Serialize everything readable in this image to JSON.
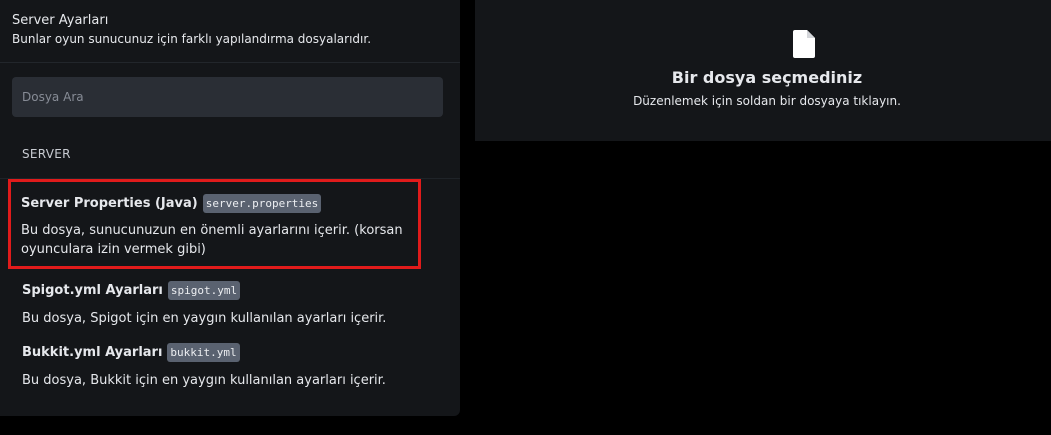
{
  "panel": {
    "title": "Server Ayarları",
    "subtitle": "Bunlar oyun sunucunuz için farklı yapılandırma dosyalarıdır."
  },
  "search": {
    "placeholder": "Dosya Ara",
    "value": ""
  },
  "section": {
    "label": "SERVER"
  },
  "files": [
    {
      "title": "Server Properties (Java)",
      "filename": "server.properties",
      "description": "Bu dosya, sunucunuzun en önemli ayarlarını içerir. (korsan oyunculara izin vermek gibi)",
      "selected": true
    },
    {
      "title": "Spigot.yml Ayarları",
      "filename": "spigot.yml",
      "description": "Bu dosya, Spigot için en yaygın kullanılan ayarları içerir.",
      "selected": false
    },
    {
      "title": "Bukkit.yml Ayarları",
      "filename": "bukkit.yml",
      "description": "Bu dosya, Bukkit için en yaygın kullanılan ayarları içerir.",
      "selected": false
    }
  ],
  "empty_state": {
    "icon": "file-icon",
    "title": "Bir dosya seçmediniz",
    "subtitle": "Düzenlemek için soldan bir dosyaya tıklayın."
  },
  "colors": {
    "background": "#000000",
    "panel": "#141619",
    "input": "#2a2e35",
    "code_badge": "#5a6270",
    "selection_outline": "#e01b1b"
  }
}
